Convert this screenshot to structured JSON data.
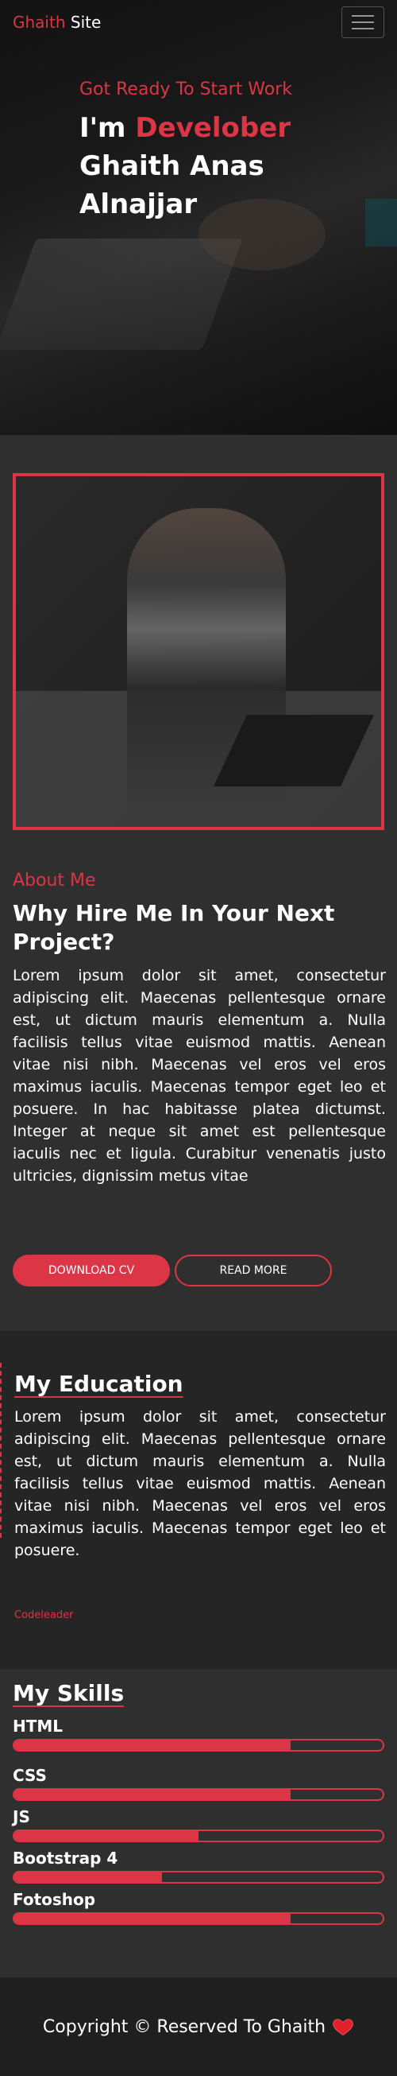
{
  "nav": {
    "brand_part1": "Ghaith",
    "brand_part2": "Site",
    "menu_icon": "hamburger-menu-icon"
  },
  "hero": {
    "subtitle": "Got Ready To Start Work",
    "title_prefix": "I'm",
    "title_highlight": "Develober",
    "name": "Ghaith Anas Alnajjar"
  },
  "about": {
    "label": "About Me",
    "title": "Why Hire Me In Your Next Project?",
    "text": "Lorem ipsum dolor sit amet, consectetur adipiscing elit. Maecenas pellentesque ornare est, ut dictum mauris elementum a. Nulla facilisis tellus vitae euismod mattis. Aenean vitae nisi nibh. Maecenas vel eros vel eros maximus iaculis. Maecenas tempor eget leo et posuere. In hac habitasse platea dictumst. Integer at neque sit amet est pellentesque iaculis nec et ligula. Curabitur venenatis justo ultricies, dignissim metus vitae",
    "download_label": "Download CV",
    "read_more_label": "Read More"
  },
  "education": {
    "title": "My Education",
    "text": "Lorem ipsum dolor sit amet, consectetur adipiscing elit. Maecenas pellentesque ornare est, ut dictum mauris elementum a. Nulla facilisis tellus vitae euismod mattis. Aenean vitae nisi nibh. Maecenas vel eros vel eros maximus iaculis. Maecenas tempor eget leo et posuere.",
    "organization": "Codeleader"
  },
  "skills": {
    "title": "My Skills",
    "items": [
      {
        "name": "HTML",
        "level": 75
      },
      {
        "name": "CSS",
        "level": 75
      },
      {
        "name": "JS",
        "level": 50
      },
      {
        "name": "Bootstrap 4",
        "level": 40
      },
      {
        "name": "Fotoshop",
        "level": 75
      }
    ]
  },
  "footer": {
    "text": "Copyright © Reserved To Ghaith",
    "icon": "heart-icon"
  },
  "colors": {
    "accent": "#dc3545",
    "background": "#2f2f2f",
    "footer": "#1f1f1f"
  }
}
